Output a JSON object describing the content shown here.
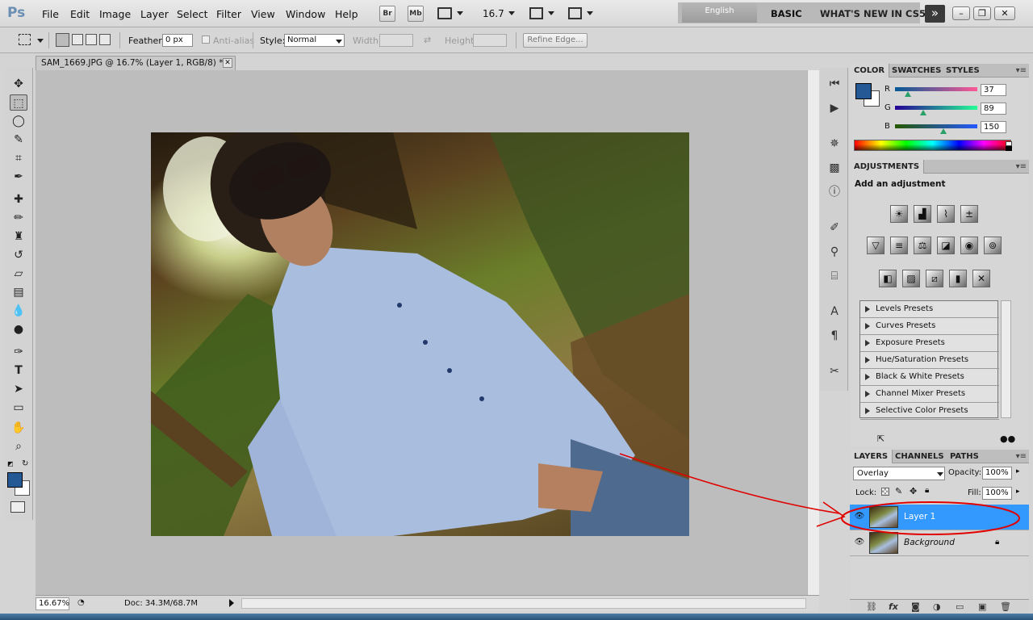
{
  "app": {
    "logo": "Ps",
    "menu": [
      "File",
      "Edit",
      "Image",
      "Layer",
      "Select",
      "Filter",
      "View",
      "Window",
      "Help"
    ],
    "bridge_btn": "Br",
    "minibridge_btn": "Mb",
    "zoom": "16.7",
    "language": "English",
    "workspace": "BASIC",
    "whats_new": "WHAT'S NEW IN CS5",
    "window_controls": [
      "minimize-icon",
      "restore-icon",
      "close-icon"
    ]
  },
  "options": {
    "feather_label": "Feather:",
    "feather_value": "0 px",
    "antialias_label": "Anti-alias",
    "style_label": "Style:",
    "style_value": "Normal",
    "width_label": "Width:",
    "height_label": "Height:",
    "refine_edge": "Refine Edge..."
  },
  "document": {
    "tab_title": "SAM_1669.JPG @ 16.7% (Layer 1, RGB/8) *",
    "zoom_status": "16.67%",
    "doc_size": "Doc: 34.3M/68.7M"
  },
  "tools": [
    "move-tool-icon",
    "marquee-tool-icon",
    "lasso-tool-icon",
    "quick-select-icon",
    "crop-tool-icon",
    "eyedropper-icon",
    "healing-brush-icon",
    "brush-tool-icon",
    "clone-stamp-icon",
    "history-brush-icon",
    "eraser-icon",
    "gradient-icon",
    "blur-icon",
    "dodge-icon",
    "pen-tool-icon",
    "type-tool-icon",
    "path-select-icon",
    "shape-tool-icon",
    "hand-tool-icon",
    "zoom-tool-icon"
  ],
  "color_panel": {
    "tabs": [
      "COLOR",
      "SWATCHES",
      "STYLES"
    ],
    "foreground": "#255996",
    "channels": [
      {
        "label": "R",
        "value": "37"
      },
      {
        "label": "G",
        "value": "89"
      },
      {
        "label": "B",
        "value": "150"
      }
    ]
  },
  "adjustments_panel": {
    "tab": "ADJUSTMENTS",
    "heading": "Add an adjustment",
    "presets": [
      "Levels Presets",
      "Curves Presets",
      "Exposure Presets",
      "Hue/Saturation Presets",
      "Black & White Presets",
      "Channel Mixer Presets",
      "Selective Color Presets"
    ]
  },
  "layers_panel": {
    "tabs": [
      "LAYERS",
      "CHANNELS",
      "PATHS"
    ],
    "blend_mode": "Overlay",
    "opacity_label": "Opacity:",
    "opacity_value": "100%",
    "lock_label": "Lock:",
    "fill_label": "Fill:",
    "fill_value": "100%",
    "layers": [
      {
        "name": "Layer 1",
        "selected": true
      },
      {
        "name": "Background",
        "selected": false
      }
    ]
  },
  "colors": {
    "selection": "#3399ff",
    "annotation": "#e00000"
  }
}
